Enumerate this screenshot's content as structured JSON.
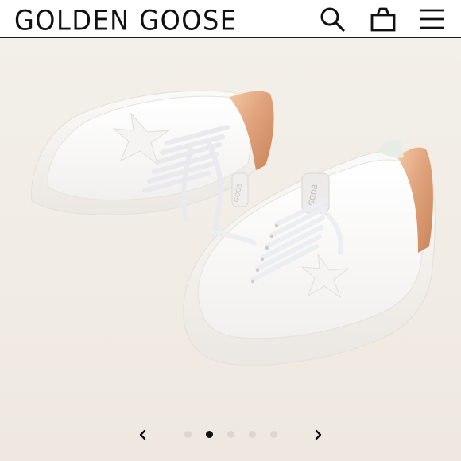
{
  "brand": {
    "name": "GOLDEN GOOSE"
  },
  "header": {
    "icons": [
      "search-icon",
      "shopping-bag-icon",
      "menu-icon"
    ]
  },
  "product_image": {
    "description_icon": "sneakers-image",
    "heel_tab_text": "GGDB"
  },
  "carousel": {
    "total_slides": 5,
    "active_index": 1,
    "prev_icon": "chevron-left-icon",
    "next_icon": "chevron-right-icon"
  },
  "colors": {
    "background": "#f1ece5",
    "text": "#111111",
    "heel_accent": "#e0a37c",
    "dot_inactive": "#dcd6cf",
    "dot_active": "#111111"
  }
}
